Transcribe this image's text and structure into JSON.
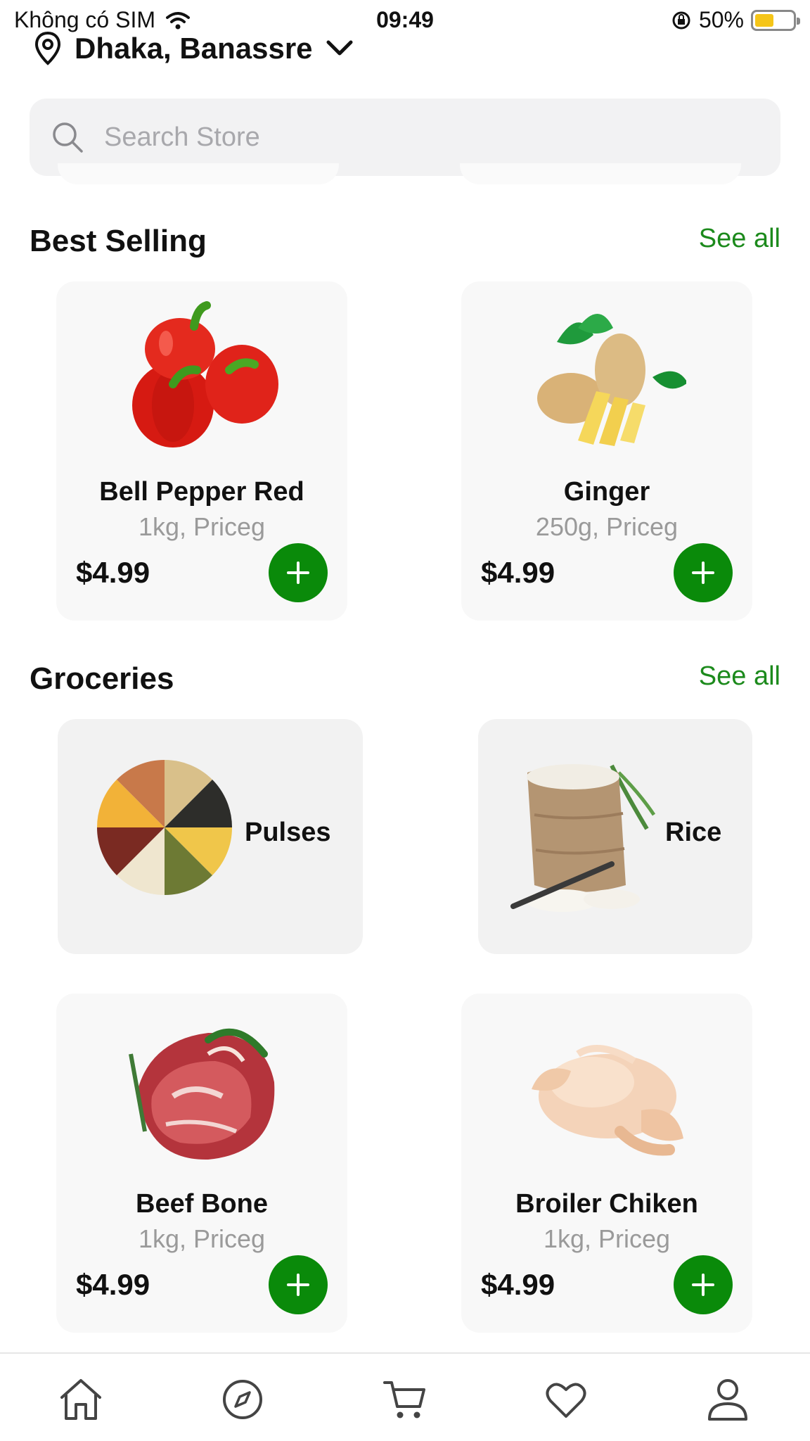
{
  "status_bar": {
    "carrier": "Không có SIM",
    "time": "09:49",
    "battery": "50%",
    "battery_level": 0.5
  },
  "location": {
    "label": "Dhaka, Banassre"
  },
  "search": {
    "placeholder": "Search Store"
  },
  "best_selling": {
    "title": "Best Selling",
    "see_all": "See all",
    "items": [
      {
        "name": "Bell Pepper Red",
        "desc": "1kg, Priceg",
        "price": "$4.99"
      },
      {
        "name": "Ginger",
        "desc": "250g, Priceg",
        "price": "$4.99"
      }
    ]
  },
  "groceries": {
    "title": "Groceries",
    "see_all": "See all",
    "categories": [
      {
        "label": "Pulses"
      },
      {
        "label": "Rice"
      }
    ],
    "items": [
      {
        "name": "Beef Bone",
        "desc": "1kg, Priceg",
        "price": "$4.99"
      },
      {
        "name": "Broiler Chiken",
        "desc": "1kg, Priceg",
        "price": "$4.99"
      }
    ]
  },
  "tabbar": {
    "tabs": [
      "home-icon",
      "explore-icon",
      "cart-icon",
      "favourite-icon",
      "account-icon"
    ]
  },
  "colors": {
    "accent": "#0a8a0a",
    "link": "#1c8a1c"
  }
}
